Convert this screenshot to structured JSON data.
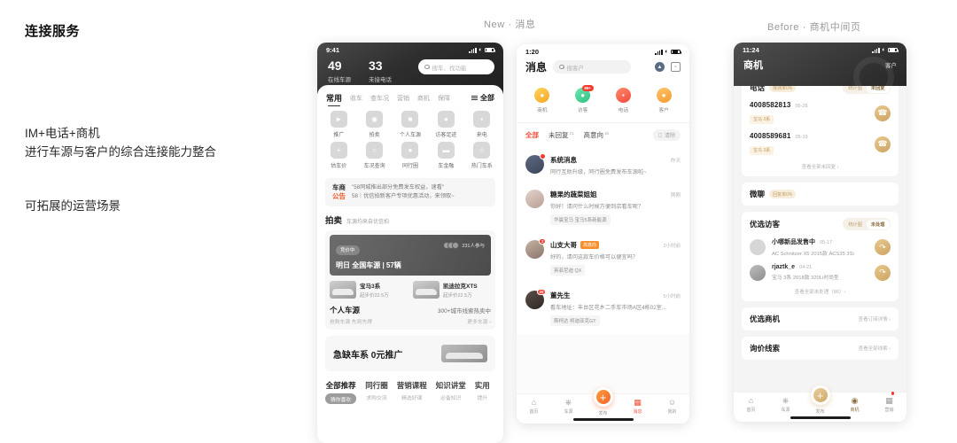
{
  "left": {
    "title": "连接服务",
    "body": "IM+电话+商机\n进行车源与客户的综合连接能力整合",
    "body2": "可拓展的运营场景"
  },
  "captions": {
    "new": "New · 消息",
    "before": "Before · 商机中间页"
  },
  "phone1": {
    "status": {
      "time": "9:41"
    },
    "stats": [
      {
        "num": "49",
        "label": "在线车源"
      },
      {
        "num": "33",
        "label": "未接电话"
      }
    ],
    "search_placeholder": "搜车、找功能",
    "tabs": [
      "常用",
      "收车",
      "查车况",
      "营销",
      "商机",
      "保障"
    ],
    "all_label": "全部",
    "grid": [
      {
        "label": "推广",
        "icon": "megaphone-icon",
        "glyph": "📢"
      },
      {
        "label": "拍卖",
        "icon": "auction-icon",
        "glyph": "拍"
      },
      {
        "label": "个人车源",
        "icon": "car-icon",
        "glyph": "🚗"
      },
      {
        "label": "访客足迹",
        "icon": "visitor-icon",
        "glyph": "👤"
      },
      {
        "label": "来电",
        "icon": "phone-icon",
        "glyph": "📱"
      },
      {
        "label": "估车价",
        "icon": "price-icon",
        "glyph": "＋"
      },
      {
        "label": "车况查询",
        "icon": "shield-search-icon",
        "glyph": "🔍"
      },
      {
        "label": "同行圈",
        "icon": "community-icon",
        "glyph": "👥"
      },
      {
        "label": "车金融",
        "icon": "wallet-icon",
        "glyph": "💳"
      },
      {
        "label": "热门车系",
        "icon": "trophy-icon",
        "glyph": "🏆"
      }
    ],
    "notice": {
      "tag_top": "车商",
      "tag_bottom": "公告",
      "line1": "\"58同城推出部分免费发车权益，速看\"",
      "line2": "58｜优信拍新客户专项优惠活动，来领取~"
    },
    "auction": {
      "title": "拍卖",
      "subtitle": "车源均来自优信拍",
      "chip": "竞价中",
      "joiners": "231人参与",
      "headline": "明日 全国车源 | 57辆",
      "cars": [
        {
          "name": "宝马3系",
          "price": "起步价22.5万"
        },
        {
          "name": "凯迪拉克XTS",
          "price": "起步价22.5万"
        }
      ],
      "row_left": "个人车源",
      "row_right": "300+城市线索热卖中",
      "row2_left": "抢购车源 先到先得",
      "row2_right": "更多车源 ›"
    },
    "promo": {
      "title": "急缺车系 0元推广"
    },
    "bottom_tabs": [
      {
        "title": "全部推荐",
        "sub": "猜你喜欢"
      },
      {
        "title": "同行圈",
        "sub": "求购交流"
      },
      {
        "title": "营销课程",
        "sub": "精选好课"
      },
      {
        "title": "知识讲堂",
        "sub": "必备知识"
      },
      {
        "title": "实用",
        "sub": "提升"
      }
    ]
  },
  "phone2": {
    "status": {
      "time": "1:20"
    },
    "title": "消息",
    "search_placeholder": "搜客户",
    "header_icons": [
      {
        "name": "scan-icon",
        "glyph": "⛶"
      },
      {
        "name": "chart-icon",
        "glyph": "▤"
      }
    ],
    "categories": [
      {
        "label": "商机",
        "icon": "lightbulb-icon",
        "glyph": "💡",
        "color": "#f7b733",
        "badge": ""
      },
      {
        "label": "访客",
        "icon": "visitor-icon",
        "glyph": "👤",
        "color": "#3fcf8e",
        "badge": "99+"
      },
      {
        "label": "电话",
        "icon": "phone-icon",
        "glyph": "📞",
        "color": "#f4604a",
        "badge": ""
      },
      {
        "label": "客户",
        "icon": "customer-icon",
        "glyph": "👥",
        "color": "#f7a93b",
        "badge": ""
      }
    ],
    "filters": [
      {
        "label": "全部",
        "count": "",
        "active": true
      },
      {
        "label": "未回复",
        "count": "21",
        "active": false
      },
      {
        "label": "高意向",
        "count": "16",
        "active": false
      }
    ],
    "clear_label": "清除",
    "messages": [
      {
        "name": "系统消息",
        "tag": "",
        "time": "昨天",
        "text": "同行互助升级，同行圈免费发布车源啦~",
        "chip": "",
        "badge": "",
        "avatar": "bell-avatar"
      },
      {
        "name": "糖果的蔬菜姐姐",
        "tag": "",
        "time": "刚刚",
        "text": "你好！请问什么时候方便到店看车呢？",
        "chip": "华晨宝马 宝马5系新能源",
        "badge": "",
        "avatar": "photo-avatar"
      },
      {
        "name": "山支大哥",
        "tag": "高意向",
        "time": "2小时前",
        "text": "好的，请问这款车价格可以便宜吗？",
        "chip": "英菲尼迪 QX",
        "badge": "2",
        "avatar": "photo-avatar"
      },
      {
        "name": "董先生",
        "tag": "",
        "time": "5小时前",
        "text": "看车地址：丰台区花乡二手车市场A区4栋02室...",
        "chip": "斯柯达 柯迪亚克GT",
        "badge": "20",
        "avatar": "photo-avatar"
      }
    ],
    "tabbar": [
      {
        "label": "首页",
        "icon": "home-icon",
        "glyph": "⌂",
        "active": false
      },
      {
        "label": "车源",
        "icon": "car-icon",
        "glyph": "🚘",
        "active": false
      },
      {
        "label": "发布",
        "icon": "plus-icon",
        "glyph": "+",
        "active": false
      },
      {
        "label": "消息",
        "icon": "message-icon",
        "glyph": "▣",
        "active": true
      },
      {
        "label": "我的",
        "icon": "profile-icon",
        "glyph": "☺",
        "active": false
      }
    ]
  },
  "phone3": {
    "status": {
      "time": "11:24"
    },
    "title": "商机",
    "header_right": "客户",
    "phone_card": {
      "heading": "电话",
      "pill": "接通率0%",
      "seg": [
        {
          "label": "统计图",
          "active": false
        },
        {
          "label": "未回复",
          "active": true
        }
      ],
      "calls": [
        {
          "number": "4008582813",
          "date": "05-26",
          "chip": "宝马 3系"
        },
        {
          "number": "4008589681",
          "date": "05-19",
          "chip": "宝马 3系"
        }
      ],
      "more": "查看全部未回复 ›"
    },
    "chat_card": {
      "heading": "微聊",
      "pill": "回复率0%"
    },
    "visitor_card": {
      "heading": "优选访客",
      "seg": [
        {
          "label": "统计图",
          "active": false
        },
        {
          "label": "未处理",
          "active": true
        }
      ],
      "visitors": [
        {
          "name": "小哪新品发售中",
          "date": "05-17",
          "sub": "AC Schnitzer X5 2015款 ACS35 3Si"
        },
        {
          "name": "rjaztk_e",
          "date": "04-21",
          "sub": "宝马 3系 2018款 320Li时尚型"
        }
      ],
      "more": "查看全部未处理（86）›"
    },
    "opportunity_card": {
      "heading": "优选商机",
      "more": "查看订阅详情 ›"
    },
    "clue_card": {
      "heading": "询价线索",
      "more": "查看全部线索 ›"
    },
    "tabbar": [
      {
        "label": "首页",
        "icon": "home-icon",
        "glyph": "⌂",
        "active": false
      },
      {
        "label": "车源",
        "icon": "car-icon",
        "glyph": "🚘",
        "active": false
      },
      {
        "label": "发布",
        "icon": "plus-icon",
        "glyph": "+",
        "active": false
      },
      {
        "label": "商机",
        "icon": "opportunity-icon",
        "glyph": "◎",
        "active": true
      },
      {
        "label": "营销",
        "icon": "marketing-icon",
        "glyph": "▣",
        "active": false
      }
    ]
  }
}
